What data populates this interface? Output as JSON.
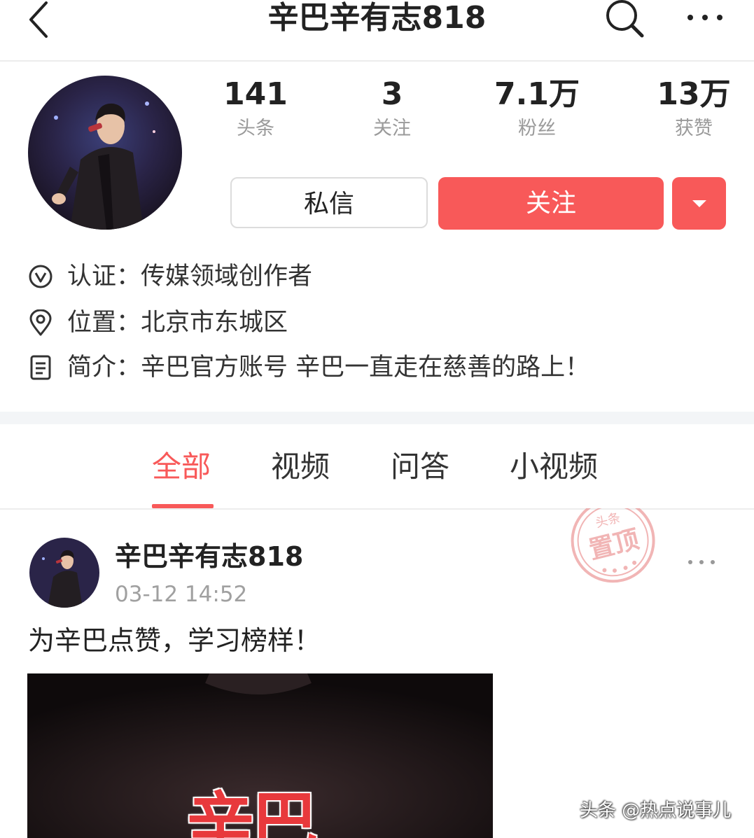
{
  "nav": {
    "title": "辛巴辛有志818",
    "back_icon": "chevron-left-icon",
    "search_icon": "search-icon",
    "more_icon": "more-horizontal-icon"
  },
  "profile": {
    "stats": [
      {
        "value": "141",
        "label": "头条"
      },
      {
        "value": "3",
        "label": "关注"
      },
      {
        "value": "7.1万",
        "label": "粉丝"
      },
      {
        "value": "13万",
        "label": "获赞"
      }
    ],
    "message_label": "私信",
    "follow_label": "关注",
    "info": {
      "verify": "认证：传媒领域创作者",
      "location": "位置：北京市东城区",
      "bio": "简介：辛巴官方账号 辛巴一直走在慈善的路上！"
    }
  },
  "tabs": [
    "全部",
    "视频",
    "问答",
    "小视频"
  ],
  "post": {
    "author": "辛巴辛有志818",
    "time": "03-12 14:52",
    "text": "为辛巴点赞，学习榜样！",
    "stamp_top": "头条",
    "stamp_main": "置顶",
    "image_text": "辛巴"
  },
  "watermark": "头条 @热点说事儿",
  "colors": {
    "accent": "#f85959",
    "muted": "#9a9a9a",
    "text": "#222222"
  }
}
